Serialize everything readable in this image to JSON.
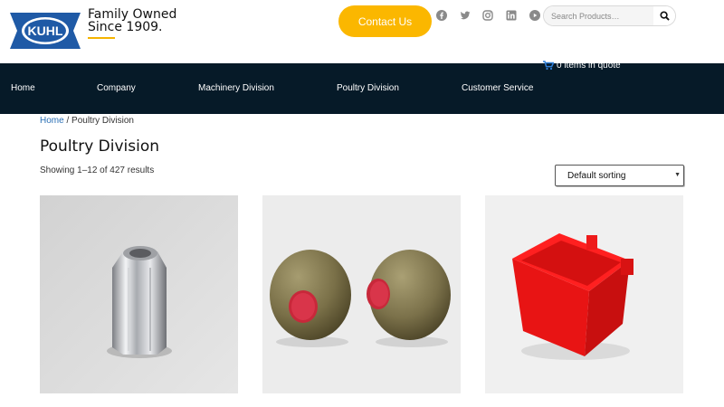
{
  "header": {
    "tagline_line1": "Family Owned",
    "tagline_line2": "Since 1909.",
    "logo_text": "KUHL",
    "contact_label": "Contact Us",
    "social_icons": [
      "facebook-icon",
      "twitter-icon",
      "instagram-icon",
      "linkedin-icon",
      "youtube-icon"
    ],
    "search_placeholder": "Search Products…",
    "quote_text": "0 items in quote"
  },
  "nav": {
    "items": [
      {
        "label": "Home"
      },
      {
        "label": "Company"
      },
      {
        "label": "Machinery Division"
      },
      {
        "label": "Poultry Division"
      },
      {
        "label": "Customer Service"
      }
    ]
  },
  "breadcrumb": {
    "home": "Home",
    "separator": " / ",
    "current": "Poultry Division"
  },
  "page": {
    "title": "Poultry Division",
    "results_text": "Showing 1–12 of 427 results",
    "sorting_selected": "Default sorting"
  },
  "products": [
    {
      "image": "chrome-hex-coupling"
    },
    {
      "image": "olive-drinker-balls-with-red-caps"
    },
    {
      "image": "red-plastic-cup"
    }
  ],
  "colors": {
    "accent": "#fbb700",
    "navbar": "#061a28",
    "link": "#2a6fb5",
    "logo_blue": "#1f5aa6"
  }
}
